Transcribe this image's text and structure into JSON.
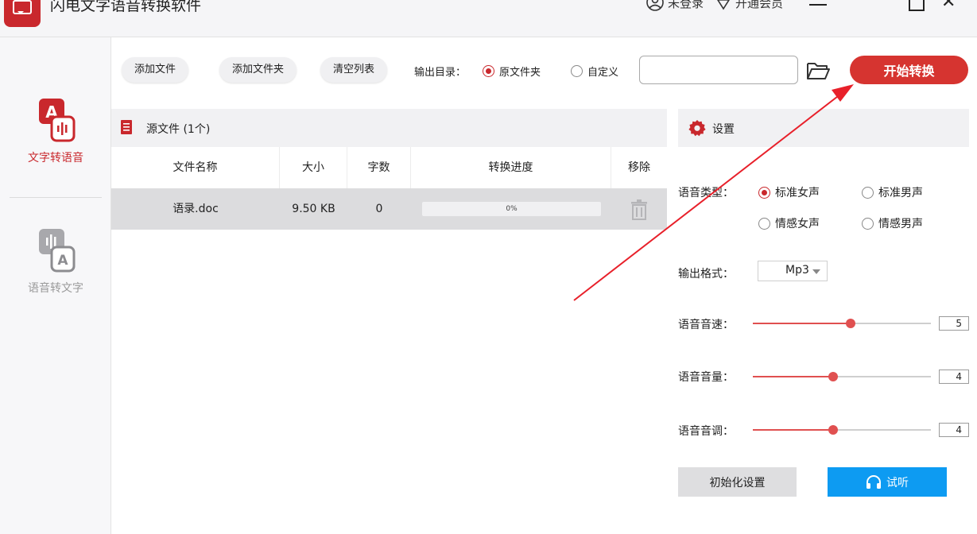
{
  "window": {
    "title": "闪电文字语音转换软件",
    "login_label": "未登录",
    "vip_label": "开通会员",
    "close_glyph": "✕"
  },
  "sidebar": {
    "items": [
      {
        "label": "文字转语音",
        "icon": "text-to-speech-icon",
        "active": true
      },
      {
        "label": "语音转文字",
        "icon": "speech-to-text-icon",
        "active": false
      }
    ]
  },
  "toolbar": {
    "add_file": "添加文件",
    "add_folder": "添加文件夹",
    "clear_list": "清空列表",
    "output_dir_label": "输出目录：",
    "opt_original": "原文件夹",
    "opt_custom": "自定义",
    "output_selected": "原文件夹",
    "path_value": "",
    "start": "开始转换"
  },
  "files": {
    "title": "源文件 (1个)",
    "columns": [
      "文件名称",
      "大小",
      "字数",
      "转换进度",
      "移除"
    ],
    "rows": [
      {
        "name": "语录.doc",
        "size": "9.50 KB",
        "count": "0",
        "progress": "0%",
        "progress_fraction": 0
      }
    ]
  },
  "settings": {
    "title": "设置",
    "voice_type_label": "语音类型：",
    "voices": [
      "标准女声",
      "标准男声",
      "情感女声",
      "情感男声"
    ],
    "voice_selected": "标准女声",
    "format_label": "输出格式：",
    "format_value": "Mp3",
    "speed_label": "语音音速：",
    "speed_value": "5",
    "speed_level": 0.55,
    "volume_label": "语音音量：",
    "volume_value": "4",
    "volume_level": 0.45,
    "pitch_label": "语音音调：",
    "pitch_value": "4",
    "pitch_level": 0.45,
    "reset": "初始化设置",
    "listen": "试听"
  },
  "colors": {
    "accent": "#d63430",
    "slider": "#e05050",
    "listen_button": "#0d9bf2",
    "annotation_arrow": "#e8202a"
  }
}
